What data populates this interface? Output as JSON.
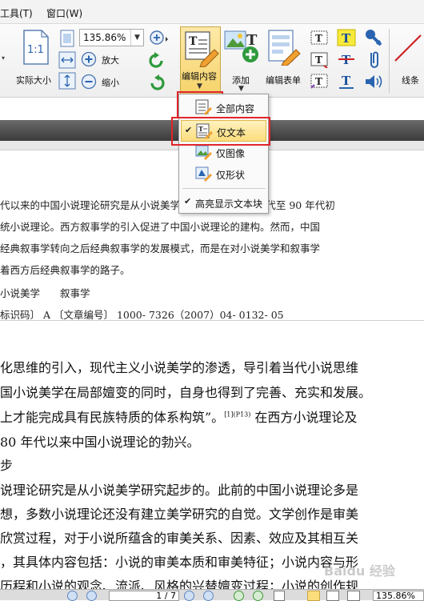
{
  "menu": {
    "tools": "工具(T)",
    "window": "窗口(W)"
  },
  "ribbon": {
    "actual_size_label": "实际大小",
    "actual_size_icon_text": "1:1",
    "zoom_value": "135.86%",
    "zoom_in_label": "放大",
    "zoom_out_label": "缩小",
    "edit_content_label": "编辑内容",
    "add_label": "添加",
    "edit_form_label": "编辑表单",
    "line_label": "线条",
    "text_tool_glyph": "T"
  },
  "dropdown": {
    "items": [
      {
        "label": "全部内容",
        "checked": false
      },
      {
        "label": "仅文本",
        "checked": true
      },
      {
        "label": "仅图像",
        "checked": false
      },
      {
        "label": "仅形状",
        "checked": false
      },
      {
        "label": "高亮显示文本块",
        "checked": true
      }
    ],
    "check_glyph": "✔"
  },
  "document": {
    "abstract_lines": [
      "代以来的中国小说理论研究是从小说美学研究起步的，80 年代至 90 年代初",
      "统小说理论。西方叙事学的引入促进了中国小说理论的建构。然而，中国",
      "经典叙事学转向之后经典叙事学的发展模式，而是在对小说美学和叙事学",
      "着西方后经典叙事学的路子。"
    ],
    "keywords": "小说美学　　叙事学",
    "identifier": "标识码〕 A 〔文章编号〕 1000- 7326（2007）04- 0132- 05",
    "body_lines": [
      "化思维的引入，现代主义小说美学的渗透，导引着当代小说思维",
      "国小说美学在局部嬗变的同时，自身也得到了完善、充实和发展。",
      "上才能完成具有民族特质的体系构筑”。",
      "80 年代以来中国小说理论的勃兴。"
    ],
    "body_line3_sup": "[1](P13)",
    "body_line3_tail": " 在西方小说理论及",
    "section_heading": "步",
    "para_lines": [
      "说理论研究是从小说美学研究起步的。此前的中国小说理论多是",
      "想，多数小说理论还没有建立美学研究的自觉。文学创作是审美",
      "欣赏过程，对于小说所蕴含的审美关系、因素、效应及其相互关",
      "，其具体内容包括：小说的审美本质和审美特征；小说内容与形",
      "历程和小说的观念、流派、风格的兴替嬗变过程；小说的创作规"
    ]
  },
  "statusbar": {
    "page": "1 / 7",
    "zoom": "135.86%"
  },
  "watermark": "Baidu 经验",
  "colors": {
    "highlight_red": "#e0262b",
    "menu_highlight": "#fbdd7c",
    "icon_blue": "#2a64b0",
    "icon_green": "#2e9a3c"
  }
}
